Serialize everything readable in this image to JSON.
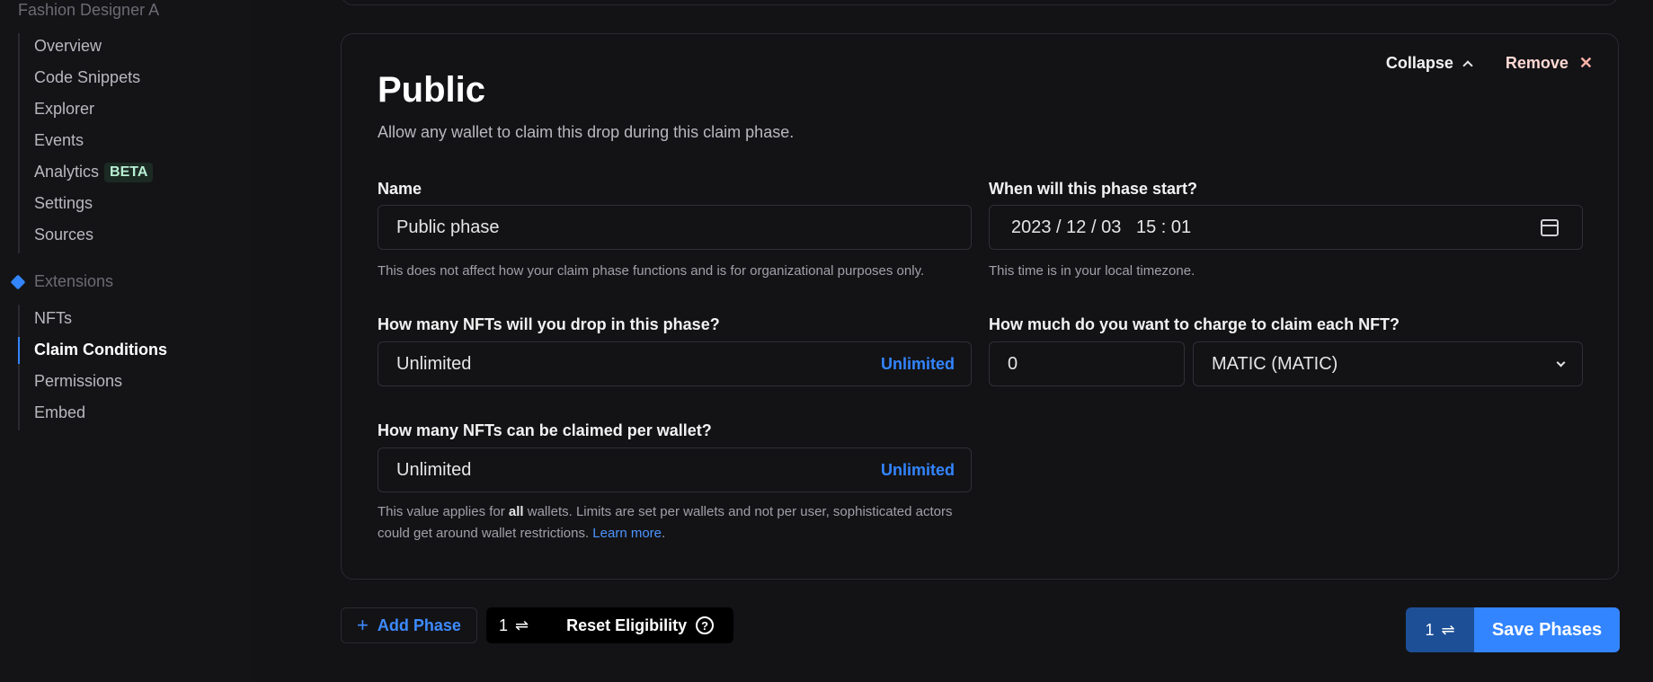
{
  "sidebar": {
    "contract_name": "Fashion Designer A",
    "items": [
      {
        "label": "Overview"
      },
      {
        "label": "Code Snippets"
      },
      {
        "label": "Explorer"
      },
      {
        "label": "Events"
      },
      {
        "label": "Analytics",
        "badge": "BETA"
      },
      {
        "label": "Settings"
      },
      {
        "label": "Sources"
      }
    ],
    "extensions_label": "Extensions",
    "extension_items": [
      {
        "label": "NFTs"
      },
      {
        "label": "Claim Conditions",
        "active": true
      },
      {
        "label": "Permissions"
      },
      {
        "label": "Embed"
      }
    ]
  },
  "phase": {
    "title": "Public",
    "description": "Allow any wallet to claim this drop during this claim phase.",
    "collapse_label": "Collapse",
    "remove_label": "Remove",
    "name_label": "Name",
    "name_value": "Public phase",
    "name_help": "This does not affect how your claim phase functions and is for organizational purposes only.",
    "start_label": "When will this phase start?",
    "start_value": "2023 / 12 / 03   15 : 01",
    "start_help": "This time is in your local timezone.",
    "drop_label": "How many NFTs will you drop in this phase?",
    "drop_value": "Unlimited",
    "drop_unlimited": "Unlimited",
    "price_label": "How much do you want to charge to claim each NFT?",
    "price_value": "0",
    "currency_value": "MATIC (MATIC)",
    "per_wallet_label": "How many NFTs can be claimed per wallet?",
    "per_wallet_value": "Unlimited",
    "per_wallet_unlimited": "Unlimited",
    "per_wallet_help_1": "This value applies for ",
    "per_wallet_help_bold": "all",
    "per_wallet_help_2": " wallets. Limits are set per wallets and not per user, sophisticated actors could get around wallet restrictions. ",
    "learn_more": "Learn more",
    "help_end": "."
  },
  "footer": {
    "add_phase": "Add Phase",
    "reset_count": "1",
    "reset_label": "Reset Eligibility",
    "save_count": "1",
    "save_label": "Save Phases"
  }
}
